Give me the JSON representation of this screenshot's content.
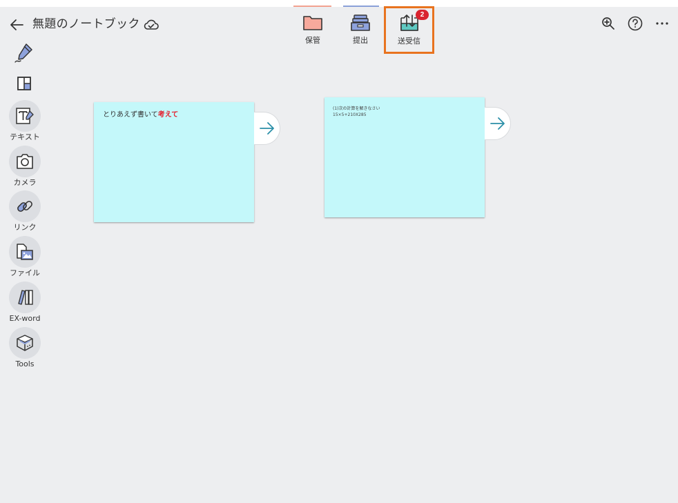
{
  "header": {
    "title": "無題のノートブック",
    "back_icon": "arrow-left-icon",
    "sync_icon": "cloud-check-icon"
  },
  "toolbar": {
    "hokan_label": "保管",
    "teishutsu_label": "提出",
    "soujushin_label": "送受信",
    "soujushin_badge": "2",
    "highlight_color": "#e8731f",
    "badge_color": "#d9242f"
  },
  "header_right": {
    "zoom_icon": "zoom-in-icon",
    "help_icon": "help-icon",
    "more_icon": "more-icon"
  },
  "sidebar": {
    "items": [
      {
        "label": "テキスト",
        "icon": "text-icon"
      },
      {
        "label": "カメラ",
        "icon": "camera-icon"
      },
      {
        "label": "リンク",
        "icon": "link-icon"
      },
      {
        "label": "ファイル",
        "icon": "file-icon"
      },
      {
        "label": "EX-word",
        "icon": "dictionary-icon"
      },
      {
        "label": "Tools",
        "icon": "tools-icon"
      }
    ]
  },
  "cards": [
    {
      "text_plain": "とりあえず書いて",
      "text_highlight": "考えて",
      "color": "#c4f8fa"
    },
    {
      "line1": "(1)次の計算を解きなさい",
      "line2": "15×5+210X285",
      "color": "#c4f8fa"
    }
  ]
}
